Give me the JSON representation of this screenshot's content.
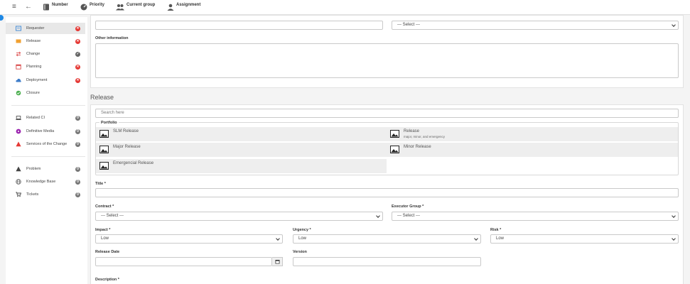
{
  "topbar": {
    "menu_icon": "≡",
    "back_icon": "←",
    "items": [
      {
        "label": "Number"
      },
      {
        "label": "Priority"
      },
      {
        "label": "Current group"
      },
      {
        "label": "Assignment"
      }
    ]
  },
  "sidebar": {
    "items": [
      {
        "label": "Requester",
        "status": "error",
        "status_glyph": "✕",
        "icon_color": "#4a90d9"
      },
      {
        "label": "Release",
        "status": "error",
        "status_glyph": "✕",
        "icon_color": "#f0a030"
      },
      {
        "label": "Change",
        "status": "ok",
        "status_glyph": "✓",
        "icon_color": "#e06060"
      },
      {
        "label": "Planning",
        "status": "error",
        "status_glyph": "✕",
        "icon_color": "#d94a4a"
      },
      {
        "label": "Deployment",
        "status": "error",
        "status_glyph": "✕",
        "icon_color": "#3d7cc9"
      },
      {
        "label": "Closure",
        "status": "none",
        "status_glyph": "",
        "icon_color": "#4caf50"
      },
      {
        "label": "Related CI",
        "status": "count",
        "status_glyph": "0",
        "icon_color": "#555555"
      },
      {
        "label": "Definitive Media",
        "status": "count",
        "status_glyph": "0",
        "icon_color": "#9c27b0"
      },
      {
        "label": "Services of the Change",
        "status": "count",
        "status_glyph": "0",
        "icon_color": "#e53935"
      },
      {
        "label": "Problem",
        "status": "count",
        "status_glyph": "0",
        "icon_color": "#444444"
      },
      {
        "label": "Knowledge Base",
        "status": "count",
        "status_glyph": "0",
        "icon_color": "#666666"
      },
      {
        "label": "Tickets",
        "status": "count",
        "status_glyph": "0",
        "icon_color": "#444444"
      }
    ]
  },
  "form_top": {
    "physical_location_value": "--- Select ---",
    "other_information_label": "Other information"
  },
  "release": {
    "section_title": "Release",
    "search_placeholder": "Search here",
    "portfolio_label": "Portfolio",
    "portfolio_items": [
      {
        "title": "SLM Release",
        "subtitle": ""
      },
      {
        "title": "Release",
        "subtitle": "major, minor, and emergency"
      },
      {
        "title": "Major Release",
        "subtitle": ""
      },
      {
        "title": "Minor Release",
        "subtitle": ""
      },
      {
        "title": "Emergencial Release",
        "subtitle": ""
      }
    ],
    "title_label": "Title *",
    "contract_label": "Contract *",
    "contract_value": "--- Select ---",
    "executor_group_label": "Executor Group *",
    "executor_group_value": "--- Select ---",
    "impact_label": "Impact *",
    "impact_value": "Low",
    "urgency_label": "Urgency *",
    "urgency_value": "Low",
    "risk_label": "Risk *",
    "risk_value": "Low",
    "release_date_label": "Release Date",
    "version_label": "Version",
    "description_label": "Description *"
  }
}
